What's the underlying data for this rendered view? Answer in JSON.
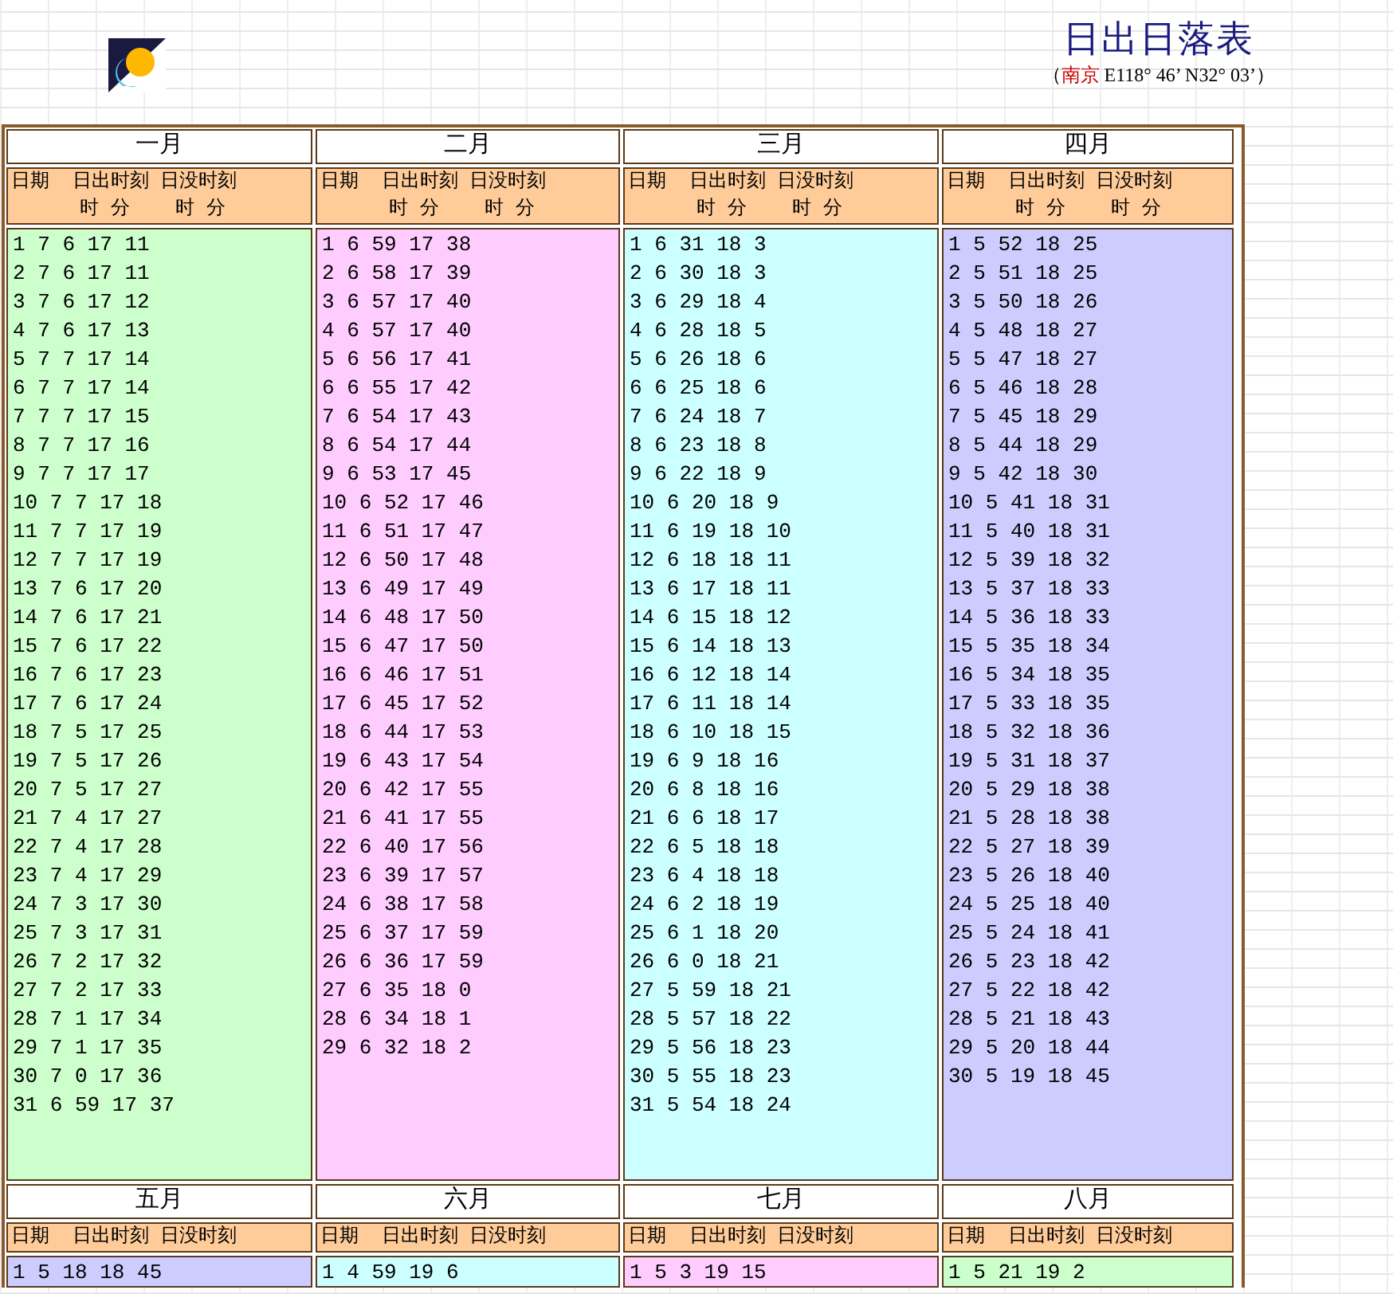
{
  "title": "日出日落表",
  "subtitle": {
    "open": "（",
    "city": "南京",
    "coords": "E118° 46’ N32° 03’",
    "close": "）"
  },
  "blocks": [
    {
      "months": [
        {
          "name": "一月",
          "header": [
            "日期  日出时刻 日没时刻",
            "      时 分    时 分"
          ],
          "color": "#ccffcc",
          "rows": [
            "1 7 6 17 11",
            "2 7 6 17 11",
            "3 7 6 17 12",
            "4 7 6 17 13",
            "5 7 7 17 14",
            "6 7 7 17 14",
            "7 7 7 17 15",
            "8 7 7 17 16",
            "9 7 7 17 17",
            "10 7 7 17 18",
            "11 7 7 17 19",
            "12 7 7 17 19",
            "13 7 6 17 20",
            "14 7 6 17 21",
            "15 7 6 17 22",
            "16 7 6 17 23",
            "17 7 6 17 24",
            "18 7 5 17 25",
            "19 7 5 17 26",
            "20 7 5 17 27",
            "21 7 4 17 27",
            "22 7 4 17 28",
            "23 7 4 17 29",
            "24 7 3 17 30",
            "25 7 3 17 31",
            "26 7 2 17 32",
            "27 7 2 17 33",
            "28 7 1 17 34",
            "29 7 1 17 35",
            "30 7 0 17 36",
            "31 6 59 17 37"
          ]
        },
        {
          "name": "二月",
          "header": [
            "日期  日出时刻 日没时刻",
            "      时 分    时 分"
          ],
          "color": "#ffccff",
          "rows": [
            "1 6 59 17 38",
            "2 6 58 17 39",
            "3 6 57 17 40",
            "4 6 57 17 40",
            "5 6 56 17 41",
            "6 6 55 17 42",
            "7 6 54 17 43",
            "8 6 54 17 44",
            "9 6 53 17 45",
            "10 6 52 17 46",
            "11 6 51 17 47",
            "12 6 50 17 48",
            "13 6 49 17 49",
            "14 6 48 17 50",
            "15 6 47 17 50",
            "16 6 46 17 51",
            "17 6 45 17 52",
            "18 6 44 17 53",
            "19 6 43 17 54",
            "20 6 42 17 55",
            "21 6 41 17 55",
            "22 6 40 17 56",
            "23 6 39 17 57",
            "24 6 38 17 58",
            "25 6 37 17 59",
            "26 6 36 17 59",
            "27 6 35 18 0",
            "28 6 34 18 1",
            "29 6 32 18 2"
          ]
        },
        {
          "name": "三月",
          "header": [
            "日期  日出时刻 日没时刻",
            "      时 分    时 分"
          ],
          "color": "#ccffff",
          "rows": [
            "1 6 31 18 3",
            "2 6 30 18 3",
            "3 6 29 18 4",
            "4 6 28 18 5",
            "5 6 26 18 6",
            "6 6 25 18 6",
            "7 6 24 18 7",
            "8 6 23 18 8",
            "9 6 22 18 9",
            "10 6 20 18 9",
            "11 6 19 18 10",
            "12 6 18 18 11",
            "13 6 17 18 11",
            "14 6 15 18 12",
            "15 6 14 18 13",
            "16 6 12 18 14",
            "17 6 11 18 14",
            "18 6 10 18 15",
            "19 6 9 18 16",
            "20 6 8 18 16",
            "21 6 6 18 17",
            "22 6 5 18 18",
            "23 6 4 18 18",
            "24 6 2 18 19",
            "25 6 1 18 20",
            "26 6 0 18 21",
            "27 5 59 18 21",
            "28 5 57 18 22",
            "29 5 56 18 23",
            "30 5 55 18 23",
            "31 5 54 18 24"
          ]
        },
        {
          "name": "四月",
          "header": [
            "日期  日出时刻 日没时刻",
            "      时 分    时 分"
          ],
          "color": "#ccccff",
          "rows": [
            "1 5 52 18 25",
            "2 5 51 18 25",
            "3 5 50 18 26",
            "4 5 48 18 27",
            "5 5 47 18 27",
            "6 5 46 18 28",
            "7 5 45 18 29",
            "8 5 44 18 29",
            "9 5 42 18 30",
            "10 5 41 18 31",
            "11 5 40 18 31",
            "12 5 39 18 32",
            "13 5 37 18 33",
            "14 5 36 18 33",
            "15 5 35 18 34",
            "16 5 34 18 35",
            "17 5 33 18 35",
            "18 5 32 18 36",
            "19 5 31 18 37",
            "20 5 29 18 38",
            "21 5 28 18 38",
            "22 5 27 18 39",
            "23 5 26 18 40",
            "24 5 25 18 40",
            "25 5 24 18 41",
            "26 5 23 18 42",
            "27 5 22 18 42",
            "28 5 21 18 43",
            "29 5 20 18 44",
            "30 5 19 18 45"
          ]
        }
      ]
    },
    {
      "months": [
        {
          "name": "五月",
          "header": [
            "日期  日出时刻 日没时刻"
          ],
          "color": "#ccccff",
          "rows": [
            "1 5 18 18 45"
          ]
        },
        {
          "name": "六月",
          "header": [
            "日期  日出时刻 日没时刻"
          ],
          "color": "#ccffff",
          "rows": [
            "1 4 59 19 6"
          ]
        },
        {
          "name": "七月",
          "header": [
            "日期  日出时刻 日没时刻"
          ],
          "color": "#ffccff",
          "rows": [
            "1 5 3 19 15"
          ]
        },
        {
          "name": "八月",
          "header": [
            "日期  日出时刻 日没时刻"
          ],
          "color": "#ccffcc",
          "rows": [
            "1 5 21 19 2"
          ]
        }
      ]
    }
  ]
}
